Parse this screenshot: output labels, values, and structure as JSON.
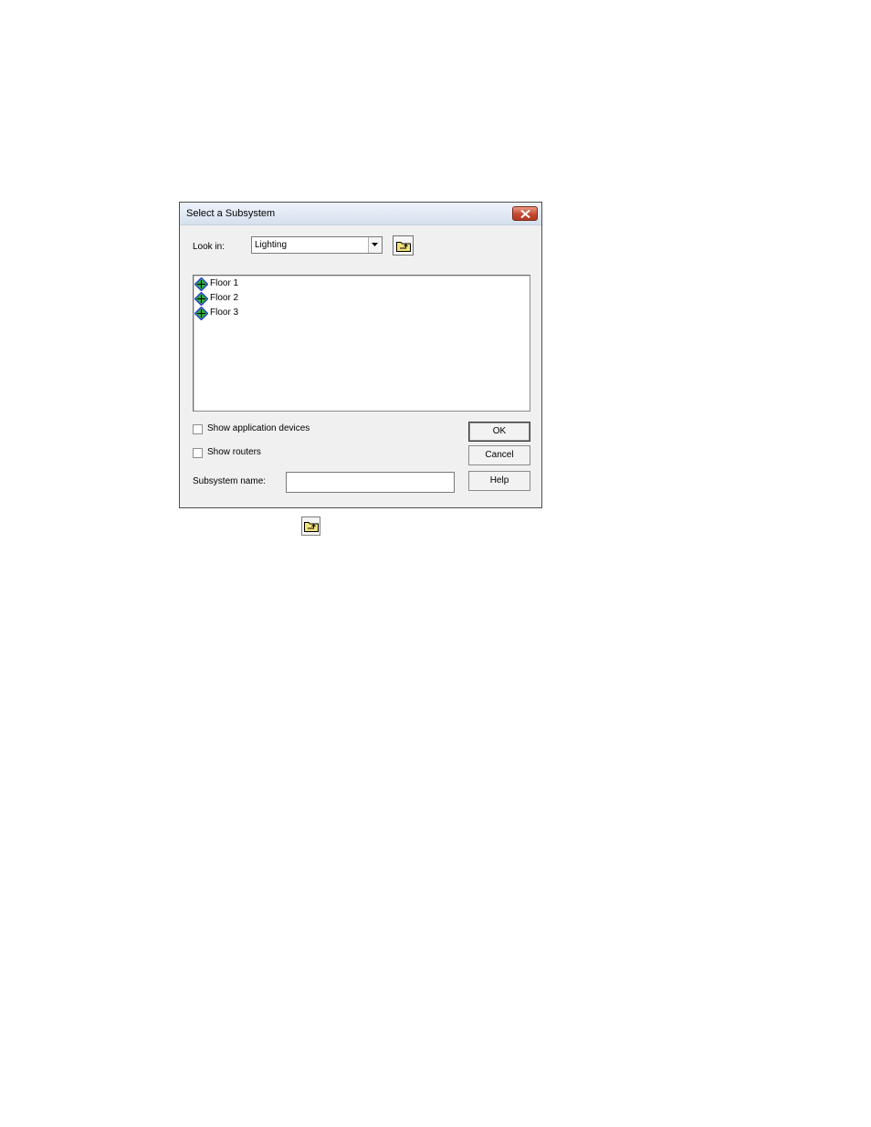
{
  "dialog": {
    "title": "Select a Subsystem",
    "look_in_label": "Look in:",
    "look_in_value": "Lighting",
    "items": [
      {
        "label": "Floor 1"
      },
      {
        "label": "Floor 2"
      },
      {
        "label": "Floor 3"
      }
    ],
    "show_application_devices_label": "Show application devices",
    "show_application_devices_checked": false,
    "show_routers_label": "Show routers",
    "show_routers_checked": false,
    "subsystem_name_label": "Subsystem name:",
    "subsystem_name_value": "",
    "ok_label": "OK",
    "cancel_label": "Cancel",
    "help_label": "Help"
  },
  "icons": {
    "close": "close-icon",
    "dropdown": "chevron-down-icon",
    "up_one_level": "folder-up-icon",
    "subsystem": "subsystem-icon"
  },
  "colors": {
    "dialog_bg": "#f0f0f0",
    "close_button": "#c34b32",
    "folder": "#f3e27a",
    "subsystem_green": "#2fae3a",
    "subsystem_blue": "#2b3fd0"
  }
}
